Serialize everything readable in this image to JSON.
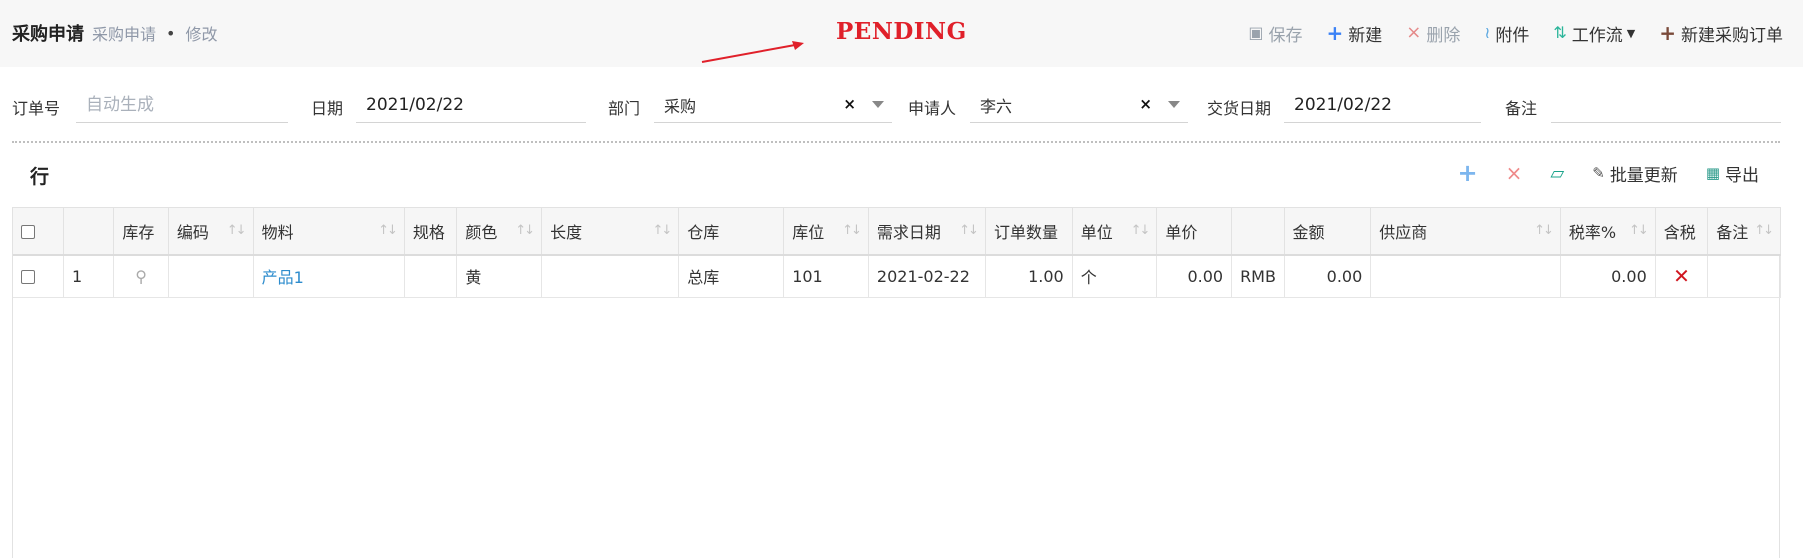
{
  "header": {
    "title": "采购申请",
    "crumb": "采购申请",
    "separator": "•",
    "mode": "修改",
    "status": "PENDING"
  },
  "toolbar": {
    "save": "保存",
    "new": "新建",
    "delete": "删除",
    "attach": "附件",
    "workflow": "工作流",
    "new_po": "新建采购订单"
  },
  "form": {
    "order_no_label": "订单号",
    "order_no_placeholder": "自动生成",
    "date_label": "日期",
    "date_value": "2021/02/22",
    "dept_label": "部门",
    "dept_value": "采购",
    "applicant_label": "申请人",
    "applicant_value": "李六",
    "delivery_label": "交货日期",
    "delivery_value": "2021/02/22",
    "note_label": "备注",
    "note_value": ""
  },
  "lines": {
    "title": "行",
    "batch_update": "批量更新",
    "export": "导出",
    "columns": [
      "",
      "",
      "库存",
      "编码",
      "物料",
      "规格",
      "颜色",
      "长度",
      "仓库",
      "库位",
      "需求日期",
      "订单数量",
      "单位",
      "单价",
      "",
      "金额",
      "供应商",
      "税率%",
      "含税",
      "备注"
    ],
    "rows": [
      {
        "no": "1",
        "code": "",
        "item": "产品1",
        "spec": "",
        "color": "黄",
        "length": "",
        "warehouse": "总库",
        "location": "101",
        "need_date": "2021-02-22",
        "qty": "1.00",
        "unit": "个",
        "price": "0.00",
        "currency": "RMB",
        "amount": "0.00",
        "supplier": "",
        "tax_rate": "0.00",
        "tax_included": false,
        "note": ""
      }
    ]
  },
  "colors": {
    "status": "#e0202a",
    "link": "#2d8ccd",
    "accent_blue": "#3b82f6",
    "danger": "#d0161f"
  }
}
